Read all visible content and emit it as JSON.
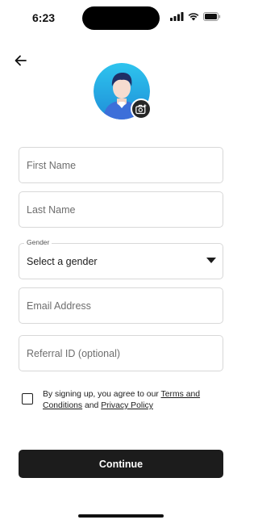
{
  "status_bar": {
    "time": "6:23"
  },
  "form": {
    "first_name_placeholder": "First Name",
    "last_name_placeholder": "Last Name",
    "gender_label": "Gender",
    "gender_value": "Select a gender",
    "email_placeholder": "Email Address",
    "referral_placeholder": "Referral ID (optional)"
  },
  "terms": {
    "prefix": "By signing up, you agree to our ",
    "terms_link": "Terms and Conditions",
    "conjunction": " and ",
    "privacy_link": "Privacy Policy"
  },
  "continue_label": "Continue",
  "colors": {
    "primary": "#1c1c1c",
    "avatar_bg": "#2bb3e8",
    "border": "#d8d8d8"
  },
  "icons": [
    "back-arrow-icon",
    "camera-add-icon",
    "caret-down-icon",
    "signal-icon",
    "wifi-icon",
    "battery-icon"
  ]
}
